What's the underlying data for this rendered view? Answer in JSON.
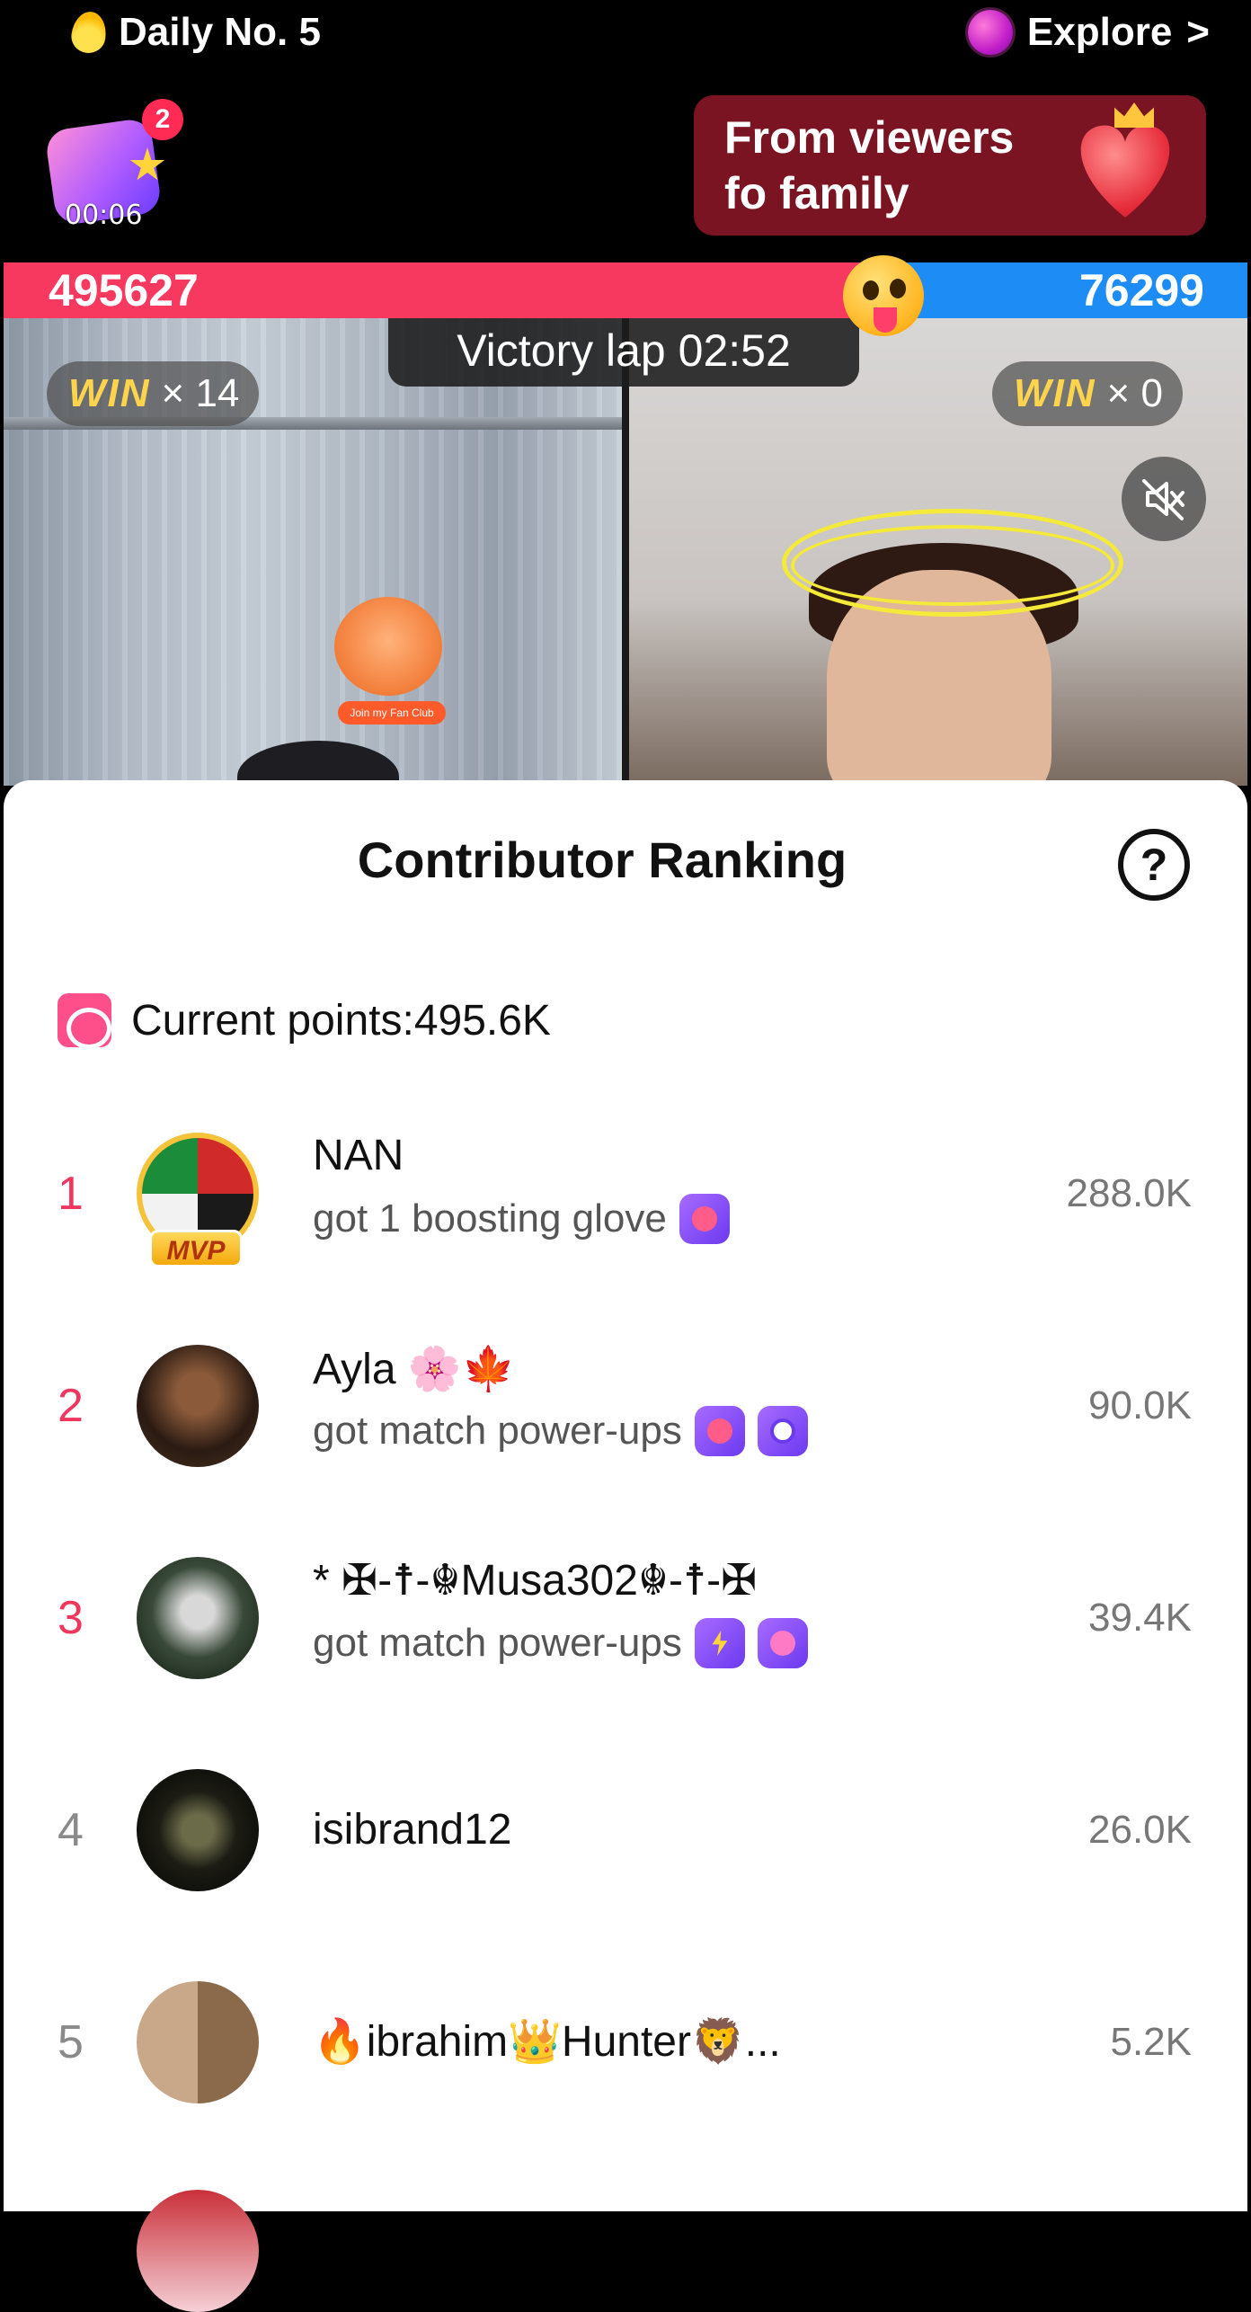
{
  "topbar": {
    "daily_label": "Daily No. 5",
    "explore_label": "Explore",
    "explore_chevron": ">"
  },
  "gift_widget": {
    "timer": "00:06",
    "badge_count": "2"
  },
  "promo": {
    "text": "From viewers fo family"
  },
  "battle": {
    "left_score": "495627",
    "right_score": "76299",
    "victory_lap": "Victory lap 02:52",
    "left_win_label": "WIN",
    "left_win_count": "× 14",
    "right_win_label": "WIN",
    "right_win_count": "× 0",
    "fan_club_text": "Join my Fan Club"
  },
  "ranking": {
    "title": "Contributor Ranking",
    "help_symbol": "?",
    "current_points": "Current points:495.6K",
    "rows": [
      {
        "rank": "1",
        "name": "NAN",
        "sub": "got 1 boosting glove",
        "score": "288.0K",
        "mvp": "MVP"
      },
      {
        "rank": "2",
        "name": "Ayla 🌸🍁",
        "sub": "got match power-ups",
        "score": "90.0K"
      },
      {
        "rank": "3",
        "name": "* ✠-☨-☬Musa302☬-☨-✠",
        "sub": "got match power-ups",
        "score": "39.4K"
      },
      {
        "rank": "4",
        "name": "isibrand12",
        "score": "26.0K"
      },
      {
        "rank": "5",
        "name": "🔥ibrahim👑Hunter🦁...",
        "score": "5.2K"
      }
    ]
  },
  "colors": {
    "accent_red": "#f7385f",
    "accent_blue": "#1e8cf5",
    "rank_top": "#f0365d",
    "promo_bg": "#7a1423"
  }
}
